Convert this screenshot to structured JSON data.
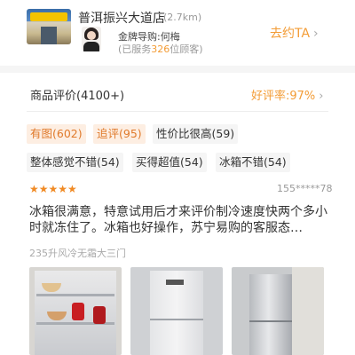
{
  "store": {
    "name": "普洱振兴大道店",
    "distance": "(2.7km)",
    "guide": "金牌导购:何梅",
    "served_prefix": "(已服务",
    "served_count": "326",
    "served_suffix": "位顾客)",
    "go_label": "去约TA",
    "chevron": "›"
  },
  "reviews": {
    "title": "商品评价(4100+)",
    "good_rate": "好评率:97%",
    "chevron": "›",
    "tags": [
      {
        "label": "有图(602)",
        "active": true
      },
      {
        "label": "追评(95)",
        "active": true
      },
      {
        "label": "性价比很高(59)",
        "active": false
      },
      {
        "label": "整体感觉不错(54)",
        "active": false
      },
      {
        "label": "买得超值(54)",
        "active": false
      },
      {
        "label": "冰箱不错(54)",
        "active": false
      }
    ],
    "first": {
      "rating": 5,
      "stars": "★★★★★",
      "user": "155*****78",
      "text": "冰箱很满意，特意试用后才来评价制冷速度快两个多小时就冻住了。冰箱也好操作，苏宁易购的客服态…",
      "product_spec": "235升风冷无霜大三门",
      "photo_count": 3
    }
  },
  "colors": {
    "accent": "#f39c36",
    "star": "#f08a24",
    "tag_active_bg": "#fdeee2"
  },
  "icons": [
    "store-photo",
    "guide-avatar-icon",
    "chevron-right-icon",
    "star-icon"
  ]
}
